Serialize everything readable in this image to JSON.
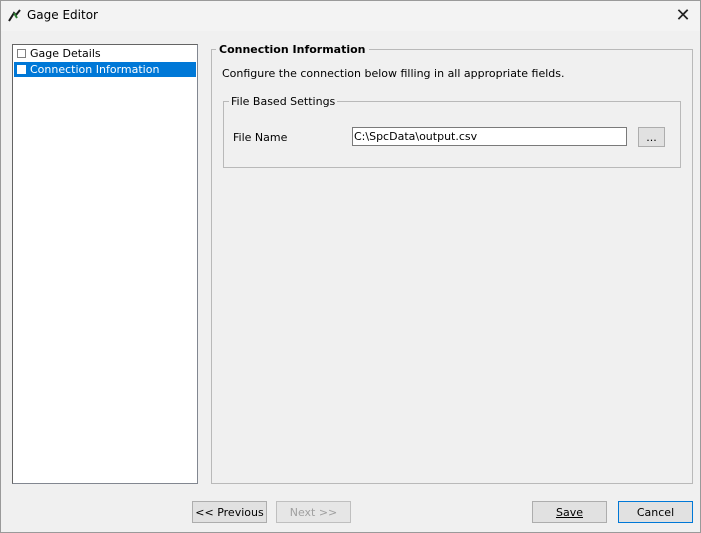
{
  "window": {
    "title": "Gage Editor",
    "close_symbol": "✕",
    "icon": "gage-app-icon"
  },
  "tree": {
    "items": [
      {
        "label": "Gage Details",
        "selected": false
      },
      {
        "label": "Connection Information",
        "selected": true
      }
    ]
  },
  "panel": {
    "title": "Connection Information",
    "description": "Configure the connection below filling in all appropriate fields.",
    "group": {
      "title": "File Based Settings",
      "file_name_label": "File Name",
      "file_name_value": "C:\\SpcData\\output.csv",
      "browse_label": "..."
    }
  },
  "buttons": {
    "previous": "<< Previous",
    "next": "Next >>",
    "save": "Save",
    "cancel": "Cancel"
  },
  "colors": {
    "selection": "#0078d7",
    "background": "#f0f0f0"
  }
}
